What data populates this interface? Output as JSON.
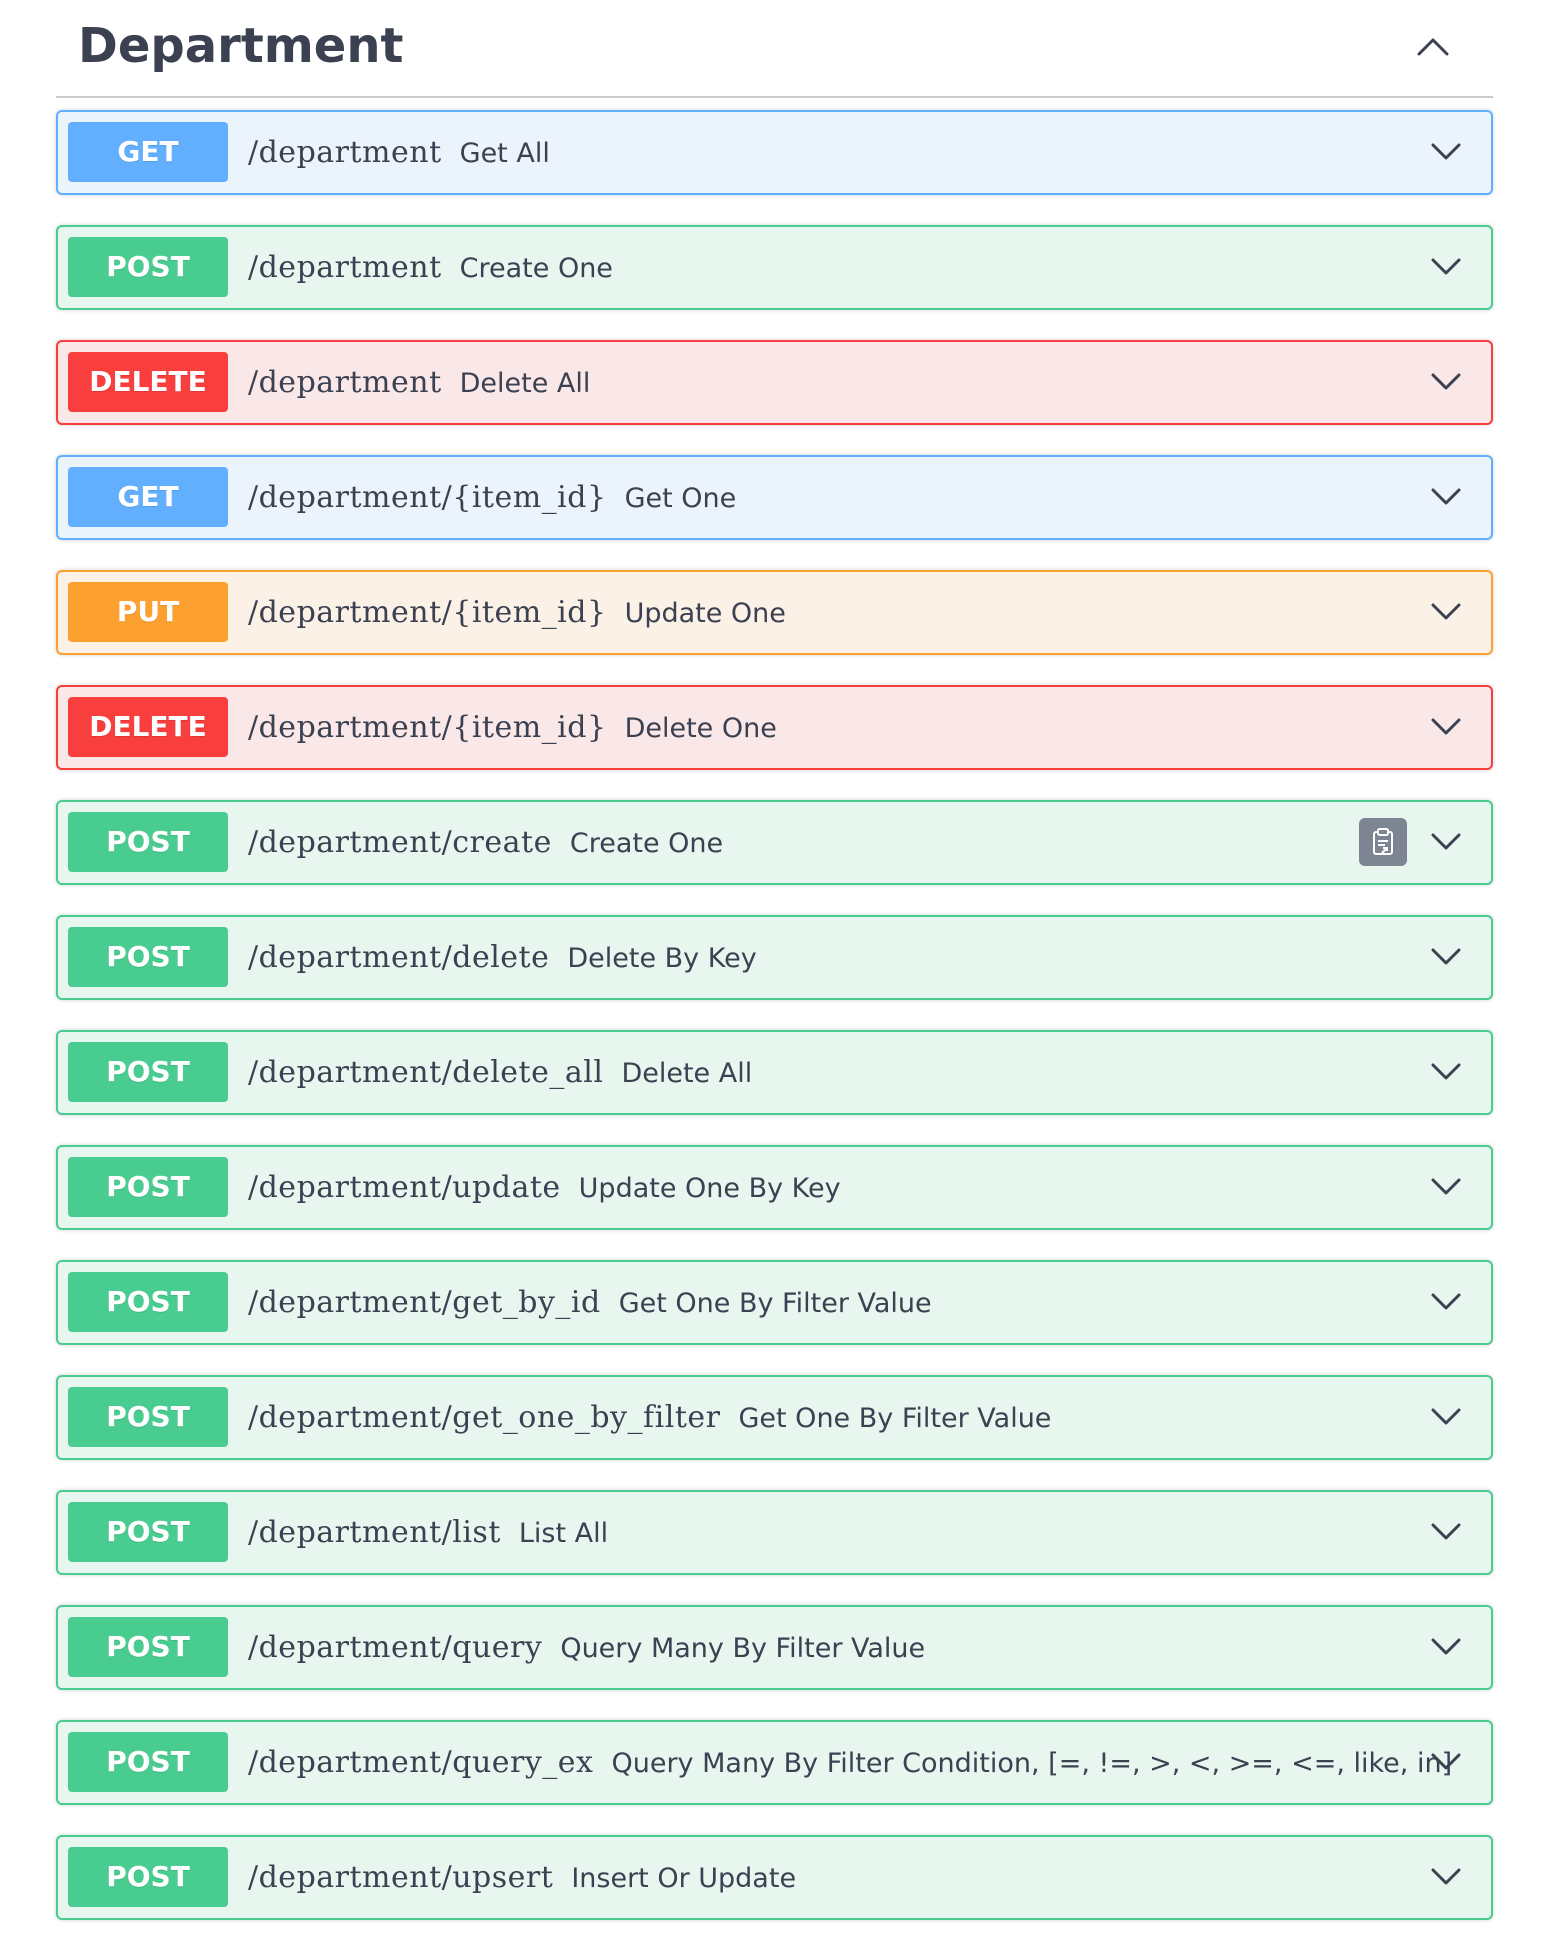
{
  "section": {
    "title": "Department"
  },
  "operations": [
    {
      "method": "GET",
      "path": "/department",
      "summary": "Get All"
    },
    {
      "method": "POST",
      "path": "/department",
      "summary": "Create One"
    },
    {
      "method": "DELETE",
      "path": "/department",
      "summary": "Delete All"
    },
    {
      "method": "GET",
      "path": "/department/{item_id}",
      "summary": "Get One"
    },
    {
      "method": "PUT",
      "path": "/department/{item_id}",
      "summary": "Update One"
    },
    {
      "method": "DELETE",
      "path": "/department/{item_id}",
      "summary": "Delete One"
    },
    {
      "method": "POST",
      "path": "/department/create",
      "summary": "Create One",
      "copy_icon": "clipboard-icon"
    },
    {
      "method": "POST",
      "path": "/department/delete",
      "summary": "Delete By Key"
    },
    {
      "method": "POST",
      "path": "/department/delete_all",
      "summary": "Delete All"
    },
    {
      "method": "POST",
      "path": "/department/update",
      "summary": "Update One By Key"
    },
    {
      "method": "POST",
      "path": "/department/get_by_id",
      "summary": "Get One By Filter Value"
    },
    {
      "method": "POST",
      "path": "/department/get_one_by_filter",
      "summary": "Get One By Filter Value"
    },
    {
      "method": "POST",
      "path": "/department/list",
      "summary": "List All"
    },
    {
      "method": "POST",
      "path": "/department/query",
      "summary": "Query Many By Filter Value"
    },
    {
      "method": "POST",
      "path": "/department/query_ex",
      "summary": "Query Many By Filter Condition, [=, !=, >, <, >=, <=, like, in]"
    },
    {
      "method": "POST",
      "path": "/department/upsert",
      "summary": "Insert Or Update"
    }
  ],
  "colors": {
    "get": "#61affe",
    "post": "#49cc90",
    "delete": "#f93e3e",
    "put": "#fca130",
    "text": "#3b4151"
  },
  "icons": {
    "collapse": "chevron-up-icon",
    "expand": "chevron-down-icon",
    "copy": "clipboard-icon"
  }
}
